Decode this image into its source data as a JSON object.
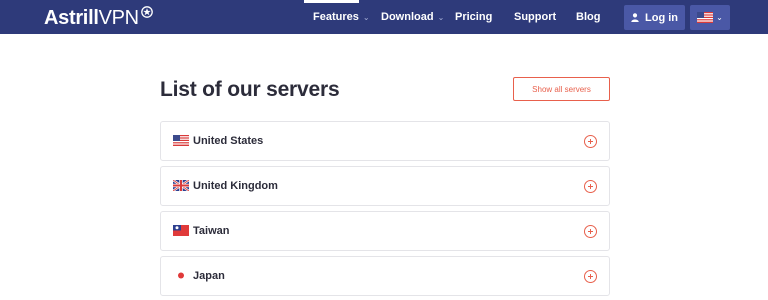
{
  "header": {
    "logo_bold": "Astrill",
    "logo_light": "VPN",
    "nav": [
      {
        "label": "Features",
        "has_dropdown": true,
        "active": true
      },
      {
        "label": "Download",
        "has_dropdown": true,
        "active": false
      },
      {
        "label": "Pricing",
        "has_dropdown": false,
        "active": false
      },
      {
        "label": "Support",
        "has_dropdown": false,
        "active": false
      },
      {
        "label": "Blog",
        "has_dropdown": false,
        "active": false
      }
    ],
    "login_label": "Log in",
    "language_flag": "us-flag-icon"
  },
  "main": {
    "title": "List of our servers",
    "show_all_label": "Show all servers",
    "servers": [
      {
        "name": "United States",
        "flag": "us-flag-icon"
      },
      {
        "name": "United Kingdom",
        "flag": "uk-flag-icon"
      },
      {
        "name": "Taiwan",
        "flag": "tw-flag-icon"
      },
      {
        "name": "Japan",
        "flag": "jp-flag-icon"
      }
    ]
  },
  "colors": {
    "header_bg": "#2e3a7a",
    "button_bg": "#4a58a6",
    "accent": "#e8604c",
    "text": "#2c2c3a"
  }
}
